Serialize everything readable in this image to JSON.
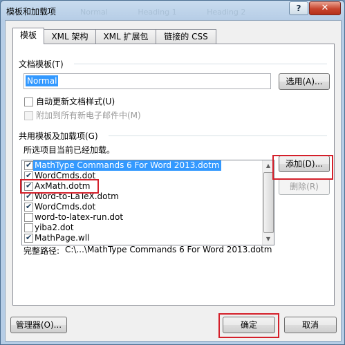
{
  "dialog": {
    "title": "模板和加载项",
    "help_button": "?",
    "close_button": "✕",
    "background_ghost_tabs": [
      "Normal",
      "Heading 1",
      "Heading 2"
    ]
  },
  "tabs": [
    {
      "label": "模板",
      "active": true
    },
    {
      "label": "XML 架构",
      "active": false
    },
    {
      "label": "XML 扩展包",
      "active": false
    },
    {
      "label": "链接的 CSS",
      "active": false
    }
  ],
  "document_template": {
    "section_label": "文档模板(T)",
    "template_value": "Normal",
    "attach_button": "选用(A)...",
    "auto_update_label": "自动更新文档样式(U)",
    "auto_update_checked": false,
    "attach_to_email_label": "附加到所有新电子邮件中(M)",
    "attach_to_email_enabled": false
  },
  "global_templates": {
    "section_label": "共用模板及加载项(G)",
    "hint": "所选项目当前已经加载。",
    "items": [
      {
        "label": "MathType Commands 6 For Word 2013.dotm",
        "checked": true,
        "selected": true
      },
      {
        "label": "WordCmds.dot",
        "checked": true,
        "selected": false
      },
      {
        "label": "AxMath.dotm",
        "checked": true,
        "selected": false
      },
      {
        "label": "Word-to-LaTeX.dotm",
        "checked": true,
        "selected": false
      },
      {
        "label": "WordCmds.dot",
        "checked": true,
        "selected": false
      },
      {
        "label": "word-to-latex-run.dot",
        "checked": false,
        "selected": false
      },
      {
        "label": "yiba2.dot",
        "checked": false,
        "selected": false
      },
      {
        "label": "MathPage.wll",
        "checked": true,
        "selected": false
      }
    ],
    "add_button": "添加(D)...",
    "remove_button": "删除(R)",
    "full_path_label": "完整路径:",
    "full_path_value": "C:\\...\\MathType Commands 6 For Word 2013.dotm"
  },
  "footer": {
    "organizer_button": "管理器(O)...",
    "ok_button": "确定",
    "cancel_button": "取消"
  },
  "colors": {
    "highlight_box": "#d41f2a",
    "selection": "#3399ff"
  }
}
